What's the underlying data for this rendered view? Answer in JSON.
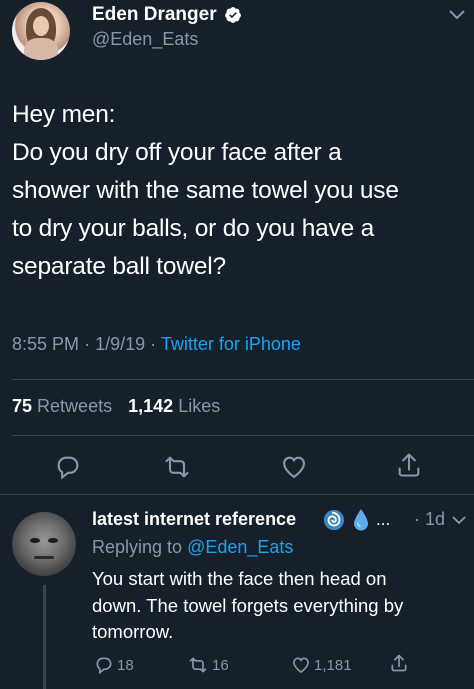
{
  "tweet": {
    "author": {
      "display_name": "Eden Dranger",
      "handle": "@Eden_Eats",
      "verified": true
    },
    "text": "Hey men:\nDo you dry off your face after a\nshower with the same towel you use\nto dry your balls, or do you have a\nseparate ball towel?",
    "time": "8:55 PM",
    "date": "1/9/19",
    "separator": "·",
    "source": "Twitter for iPhone",
    "retweets_count": "75",
    "retweets_label": "Retweets",
    "likes_count": "1,142",
    "likes_label": "Likes",
    "actions": [
      "reply-icon",
      "retweet-icon",
      "like-icon",
      "share-icon"
    ]
  },
  "reply": {
    "author": {
      "display_name": "latest internet reference",
      "ellipsis": "...",
      "emojis": [
        "cyclone-emoji",
        "droplet-emoji"
      ]
    },
    "age": "· 1d",
    "replying_prefix": "Replying to",
    "replying_to": "@Eden_Eats",
    "text": "You start with the face then head on\ndown. The towel forgets everything by\ntomorrow.",
    "counts": {
      "replies": "18",
      "retweets": "16",
      "likes": "1,181"
    }
  },
  "colors": {
    "background": "#15202b",
    "text_primary": "#ffffff",
    "text_secondary": "#8899a6",
    "accent": "#1da1f2",
    "divider": "#38444d"
  }
}
